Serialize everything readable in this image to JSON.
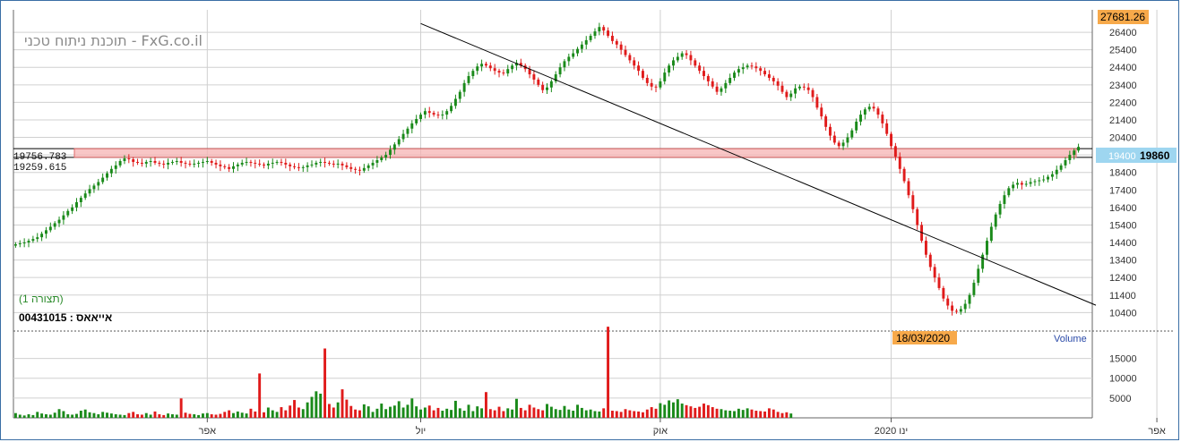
{
  "chart_data": [
    {
      "type": "candlestick",
      "title": "תוכנת ניתוח טכני - FxG.co.il",
      "subtitle": "(תצורה 1)",
      "instrument_label": "אייאאס : 00431015",
      "ylim": [
        9600,
        27681.26
      ],
      "y_ticks": [
        "26400",
        "25400",
        "24400",
        "23400",
        "22400",
        "21400",
        "20400",
        "19400",
        "18400",
        "17400",
        "16400",
        "15400",
        "14400",
        "13400",
        "12400",
        "11400",
        "10400"
      ],
      "price_top_label": "27681.26",
      "current_price": "19860",
      "current_tick": "19400",
      "date_badge": "18/03/2020",
      "support_zone": {
        "upper": "19756.783",
        "lower": "19259.615",
        "upper_value": 19756.783,
        "lower_value": 19259.615
      },
      "x_labels": [
        "אפר",
        "יול",
        "אוק",
        "ינו 2020",
        "אפר"
      ],
      "grid": true,
      "trendline": {
        "from": {
          "bar": 93,
          "value": 26900
        },
        "to": {
          "bar": 173,
          "value": 18600
        }
      },
      "series": [
        {
          "values": [
            14300,
            14350,
            14400,
            14500,
            14600,
            14700,
            14900,
            15100,
            15300,
            15500,
            15700,
            15950,
            16200,
            16400,
            16700,
            16950,
            17200,
            17450,
            17650,
            17850,
            18100,
            18350,
            18600,
            18800,
            19050,
            19200,
            19150,
            19000,
            18950,
            18900,
            19000,
            19050,
            18950,
            18900,
            18850,
            18950,
            19000,
            19050,
            18950,
            18900,
            18850,
            18900,
            18950,
            19000,
            19050,
            18950,
            18850,
            18750,
            18700,
            18600,
            18750,
            18850,
            18950,
            19000,
            18950,
            18900,
            18850,
            18800,
            18900,
            18950,
            19000,
            18950,
            18850,
            18750,
            18700,
            18650,
            18700,
            18800,
            18850,
            18950,
            19000,
            18950,
            18900,
            18850,
            18900,
            18800,
            18700,
            18600,
            18550,
            18500,
            18650,
            18800,
            18950,
            19100,
            19250,
            19400,
            19700,
            20000,
            20300,
            20600,
            20900,
            21200,
            21450,
            21700,
            21900,
            21800,
            21700,
            21650,
            21700,
            21900,
            22200,
            22600,
            23000,
            23500,
            23900,
            24200,
            24450,
            24600,
            24500,
            24350,
            24200,
            24100,
            24050,
            24300,
            24500,
            24650,
            24500,
            24300,
            24000,
            23700,
            23400,
            23100,
            23250,
            23600,
            24000,
            24400,
            24750,
            25000,
            25200,
            25450,
            25700,
            25950,
            26200,
            26450,
            26700,
            26500,
            26200,
            25900,
            25700,
            25400,
            25100,
            24800,
            24500,
            24200,
            23800,
            23500,
            23300,
            23250,
            23600,
            24100,
            24500,
            24800,
            25000,
            25200,
            25100,
            24800,
            24500,
            24200,
            23900,
            23600,
            23300,
            23000,
            23200,
            23500,
            23800,
            24100,
            24300,
            24400,
            24500,
            24450,
            24350,
            24200,
            24000,
            23800,
            23600,
            23350,
            23000,
            22700,
            22900,
            23200,
            23300,
            23250,
            23100,
            22700,
            22100,
            21600,
            21000,
            20500,
            20100,
            19900,
            20100,
            20400,
            20800,
            21300,
            21700,
            22000,
            22150,
            22050,
            21700,
            21200,
            20600,
            19900,
            19300,
            18600,
            17900,
            17100,
            16300,
            15400,
            14500,
            13700,
            13000,
            12400,
            11800,
            11200,
            10800,
            10500,
            10450,
            10600,
            10900,
            11400,
            12100,
            12900,
            13700,
            14500,
            15300,
            16000,
            16600,
            17100,
            17500,
            17700,
            17800,
            17700,
            17750,
            17850,
            17900,
            17950,
            18000,
            18150,
            18300,
            18550,
            18800,
            19100,
            19400,
            19650,
            19860
          ]
        },
        {
          "name": "Volume",
          "values": [
            1200,
            800,
            600,
            900,
            700,
            1500,
            1100,
            900,
            800,
            1300,
            2200,
            1700,
            900,
            800,
            1000,
            1800,
            2100,
            1400,
            1200,
            900,
            1500,
            1300,
            1100,
            900,
            800,
            700,
            1200,
            1500,
            900,
            800,
            1200,
            800,
            1600,
            900,
            700,
            1100,
            900,
            800,
            4900,
            1300,
            1000,
            900,
            700,
            1100,
            1200,
            900,
            800,
            1000,
            1500,
            1900,
            1200,
            1600,
            1300,
            1100,
            2300,
            1600,
            11200,
            1400,
            2600,
            1900,
            1500,
            2700,
            1900,
            3100,
            4500,
            2600,
            2200,
            3900,
            5300,
            6700,
            6100,
            17500,
            3500,
            2600,
            3900,
            7200,
            4600,
            3000,
            2100,
            1900,
            3400,
            2900,
            1500,
            2300,
            3600,
            2200,
            2800,
            3100,
            4200,
            2600,
            3300,
            4900,
            2900,
            2100,
            2600,
            3100,
            1900,
            2500,
            1800,
            2300,
            2000,
            4300,
            2400,
            1800,
            3300,
            1700,
            2900,
            2400,
            6500,
            2200,
            1900,
            2800,
            1700,
            2400,
            2100,
            4800,
            2500,
            1900,
            3300,
            2600,
            2200,
            1900,
            3500,
            2800,
            2200,
            2000,
            3000,
            2100,
            1800,
            3300,
            2500,
            1900,
            2100,
            1700,
            1600,
            2400,
            23000,
            1800,
            1700,
            1500,
            2200,
            1900,
            1700,
            1600,
            1400,
            2100,
            2700,
            2300,
            3700,
            3300,
            4400,
            3900,
            4700,
            3600,
            3200,
            2900,
            2500,
            2800,
            3600,
            3200,
            2700,
            2300,
            2200,
            1900,
            1800,
            1700,
            2300,
            2000,
            2400,
            2100,
            1800,
            1700,
            1600,
            2400,
            2100,
            1500,
            1200,
            1400,
            1100
          ]
        }
      ]
    }
  ],
  "volume_axis": {
    "ticks": [
      "15000",
      "10000",
      "5000"
    ],
    "label": "Volume",
    "ylim": [
      0,
      21000
    ]
  },
  "colors": {
    "up": "#1a8a1a",
    "down": "#e01b1b",
    "grid": "#d0d0d0",
    "zone": "#f5b3b3",
    "zone_border": "#e06a6a",
    "price_box": "#9ed6f0",
    "top_box": "#f7a94a",
    "date_box": "#f7a94a"
  }
}
